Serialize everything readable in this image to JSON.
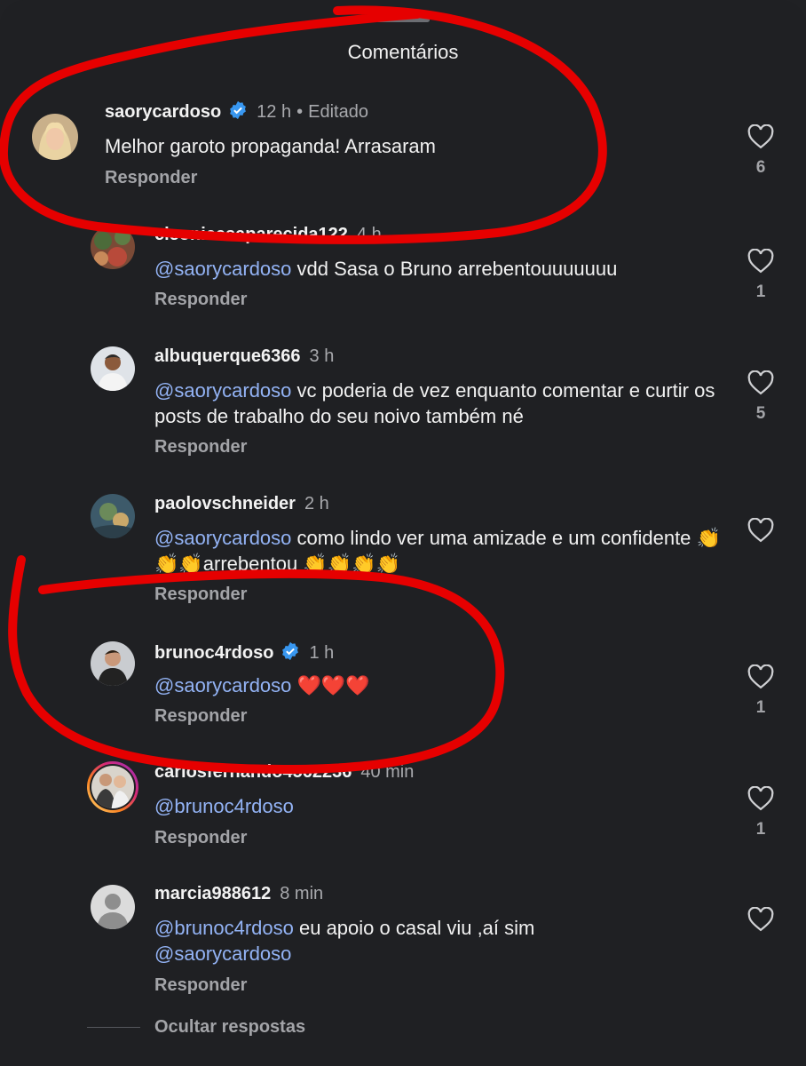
{
  "header": {
    "title": "Comentários"
  },
  "reply_label": "Responder",
  "hide_replies": "Ocultar respostas",
  "colors": {
    "background": "#1f2023",
    "mention": "#93b3f5",
    "verified": "#3897f0",
    "annotation": "#e60000"
  },
  "comments": [
    {
      "username": "saorycardoso",
      "verified": true,
      "time": "12 h",
      "edited": "Editado",
      "text": "Melhor garoto propaganda! Arrasaram",
      "likes": "6"
    },
    {
      "username": "cleonicesaparecida122",
      "verified": false,
      "time": "4 h",
      "mention": "@saorycardoso",
      "text": " vdd Sasa  o Bruno arrebentouuuuuuu",
      "likes": "1"
    },
    {
      "username": "albuquerque6366",
      "verified": false,
      "time": "3 h",
      "mention": "@saorycardoso",
      "text": " vc poderia de vez enquanto comentar e curtir os posts de trabalho do seu noivo também né",
      "likes": "5"
    },
    {
      "username": "paolovschneider",
      "verified": false,
      "time": "2 h",
      "mention": "@saorycardoso",
      "text": " como lindo ver uma amizade e um confidente 👏👏👏arrebentou 👏👏👏👏",
      "likes": ""
    },
    {
      "username": "brunoc4rdoso",
      "verified": true,
      "time": "1 h",
      "mention": "@saorycardoso",
      "text": " ❤️❤️❤️",
      "likes": "1"
    },
    {
      "username": "carlosfernando4562236",
      "verified": false,
      "time": "40 min",
      "mention": "@brunoc4rdoso",
      "text": "",
      "likes": "1"
    },
    {
      "username": "marcia988612",
      "verified": false,
      "time": "8 min",
      "mention": "@brunoc4rdoso",
      "text": " eu apoio o casal viu ,aí sim",
      "mention2": "@saorycardoso",
      "likes": ""
    }
  ]
}
